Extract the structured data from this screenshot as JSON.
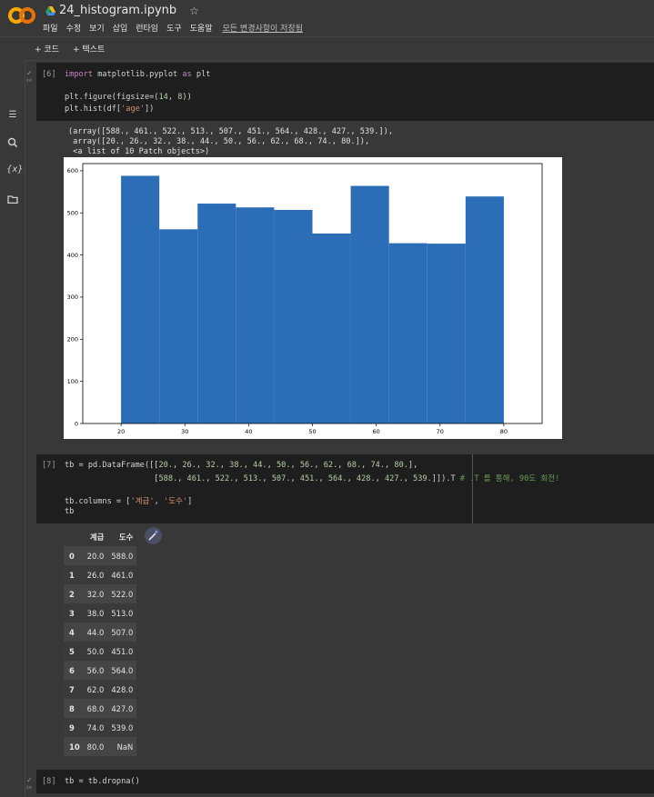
{
  "app": {
    "filename": "24_histogram.ipynb",
    "menu": [
      "파일",
      "수정",
      "보기",
      "삽입",
      "런타임",
      "도구",
      "도움말"
    ],
    "save_status": "모든 변경사항이 저장됨",
    "toolbar": {
      "add_code": "+ 코드",
      "add_text": "+ 텍스트"
    }
  },
  "icons": {
    "logo": "colab-logo-icon",
    "drive": "drive-icon",
    "star": "star-icon",
    "toc": "table-of-contents-icon",
    "search": "search-icon",
    "variables": "variables-icon",
    "files": "folder-icon",
    "exec_ok": "check-icon",
    "wand": "magic-wand-icon"
  },
  "cells": [
    {
      "prompt": "[6]",
      "lines": [
        "import matplotlib.pyplot as plt",
        "",
        "plt.figure(figsize=(14, 8))",
        "plt.hist(df['age'])"
      ],
      "output_text": [
        "(array([588., 461., 522., 513., 507., 451., 564., 428., 427., 539.]),",
        " array([20., 26., 32., 38., 44., 50., 56., 62., 68., 74., 80.]),",
        " <a list of 10 Patch objects>)"
      ]
    },
    {
      "prompt": "[7]",
      "lines": [
        "tb = pd.DataFrame([[20., 26., 32., 38., 44., 50., 56., 62., 68., 74., 80.],",
        "                   [588., 461., 522., 513., 507., 451., 564., 428., 427., 539.]]).T",
        "",
        "tb.columns = ['계급', '도수']",
        "tb"
      ],
      "comment": "# .T 를 통해, 90도 회전!"
    },
    {
      "prompt": "[8]",
      "lines": [
        "tb = tb.dropna()"
      ]
    }
  ],
  "chart_data": {
    "type": "bar",
    "bins": [
      20,
      26,
      32,
      38,
      44,
      50,
      56,
      62,
      68,
      74,
      80
    ],
    "values": [
      588,
      461,
      522,
      513,
      507,
      451,
      564,
      428,
      427,
      539
    ],
    "xticks": [
      "20",
      "30",
      "40",
      "50",
      "60",
      "70",
      "80"
    ],
    "yticks": [
      "0",
      "100",
      "200",
      "300",
      "400",
      "500",
      "600"
    ],
    "xlim": [
      14,
      86
    ],
    "ylim": [
      0,
      617
    ],
    "bar_color": "#2b6db6"
  },
  "table": {
    "columns": [
      "계급",
      "도수"
    ],
    "rows": [
      {
        "idx": "0",
        "a": "20.0",
        "b": "588.0"
      },
      {
        "idx": "1",
        "a": "26.0",
        "b": "461.0"
      },
      {
        "idx": "2",
        "a": "32.0",
        "b": "522.0"
      },
      {
        "idx": "3",
        "a": "38.0",
        "b": "513.0"
      },
      {
        "idx": "4",
        "a": "44.0",
        "b": "507.0"
      },
      {
        "idx": "5",
        "a": "50.0",
        "b": "451.0"
      },
      {
        "idx": "6",
        "a": "56.0",
        "b": "564.0"
      },
      {
        "idx": "7",
        "a": "62.0",
        "b": "428.0"
      },
      {
        "idx": "8",
        "a": "68.0",
        "b": "427.0"
      },
      {
        "idx": "9",
        "a": "74.0",
        "b": "539.0"
      },
      {
        "idx": "10",
        "a": "80.0",
        "b": "NaN"
      }
    ]
  }
}
